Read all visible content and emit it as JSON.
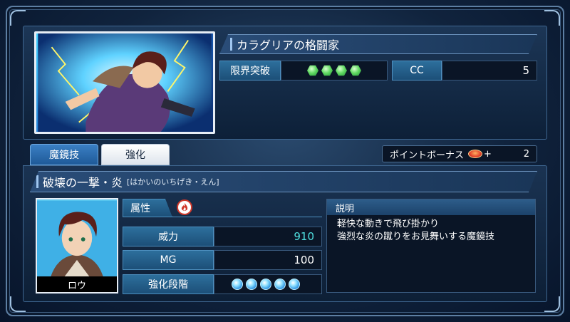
{
  "card": {
    "title": "カラグリアの格闘家",
    "limit_break_label": "限界突破",
    "limit_break_level": 4,
    "cc_label": "CC",
    "cc_value": "5"
  },
  "tabs": {
    "active_label": "魔鏡技",
    "inactive_label": "強化"
  },
  "point_bonus": {
    "label": "ポイントボーナス",
    "plus": "+",
    "value": "2"
  },
  "skill": {
    "name": "破壊の一撃・炎",
    "reading": "[はかいのいちげき・えん]",
    "character_name": "ロウ",
    "attribute_label": "属性",
    "attribute_icon": "fire-icon",
    "power_label": "威力",
    "power_value": "910",
    "mg_label": "MG",
    "mg_value": "100",
    "upgrade_label": "強化段階",
    "upgrade_level": 5,
    "description_label": "説明",
    "description_line1": "軽快な動きで飛び掛かり",
    "description_line2": "強烈な炎の蹴りをお見舞いする魔鏡技"
  },
  "colors": {
    "power_value": "#4fe0e0",
    "gem": "#5fd860",
    "orb": "#2a8fe0",
    "accent_blue": "#2d6f9c"
  }
}
